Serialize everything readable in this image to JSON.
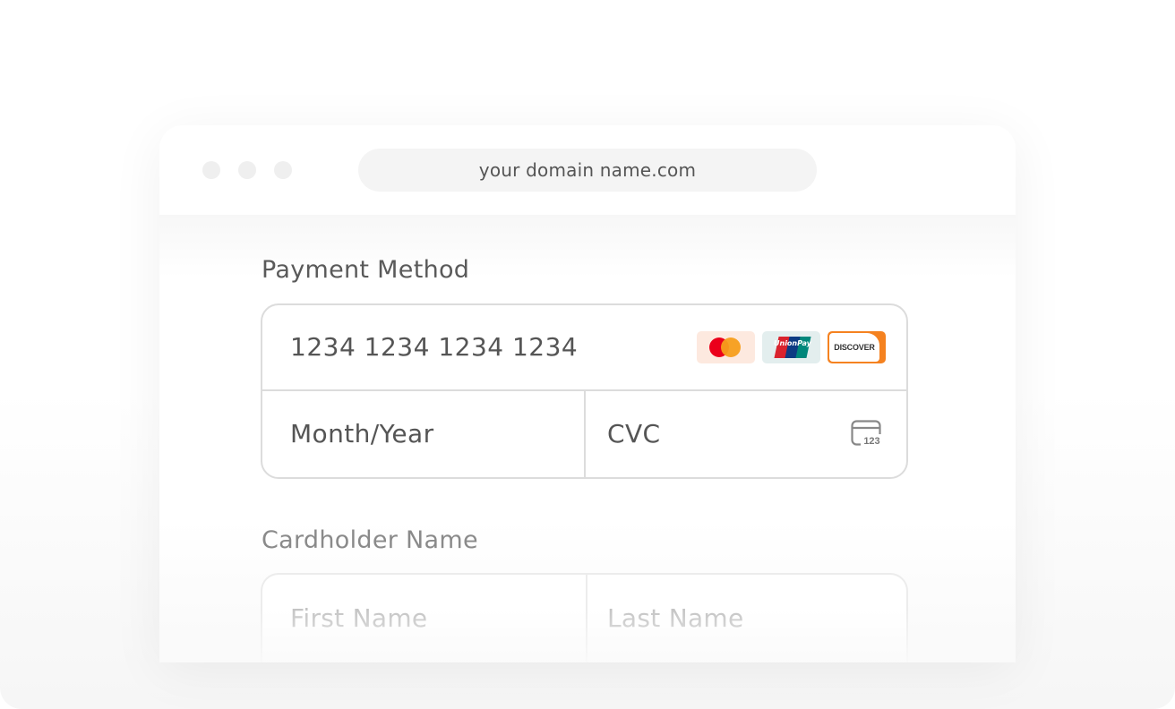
{
  "browser": {
    "url": "your domain name.com"
  },
  "payment": {
    "title": "Payment Method",
    "card_number_placeholder": "1234 1234 1234 1234",
    "expiry_placeholder": "Month/Year",
    "cvc_placeholder": "CVC",
    "cvc_icon_text": "123",
    "card_logos": [
      {
        "name": "mastercard",
        "icon": "mastercard-logo"
      },
      {
        "name": "unionpay",
        "icon": "unionpay-logo",
        "text": "UnionPay"
      },
      {
        "name": "discover",
        "icon": "discover-logo",
        "text": "DISCOVER"
      }
    ]
  },
  "cardholder": {
    "title": "Cardholder Name",
    "first_name_placeholder": "First Name",
    "last_name_placeholder": "Last Name"
  },
  "colors": {
    "mastercard_red": "#eb001b",
    "mastercard_orange": "#f79e1b",
    "discover_orange": "#f58220",
    "border": "#dcdcdc"
  }
}
